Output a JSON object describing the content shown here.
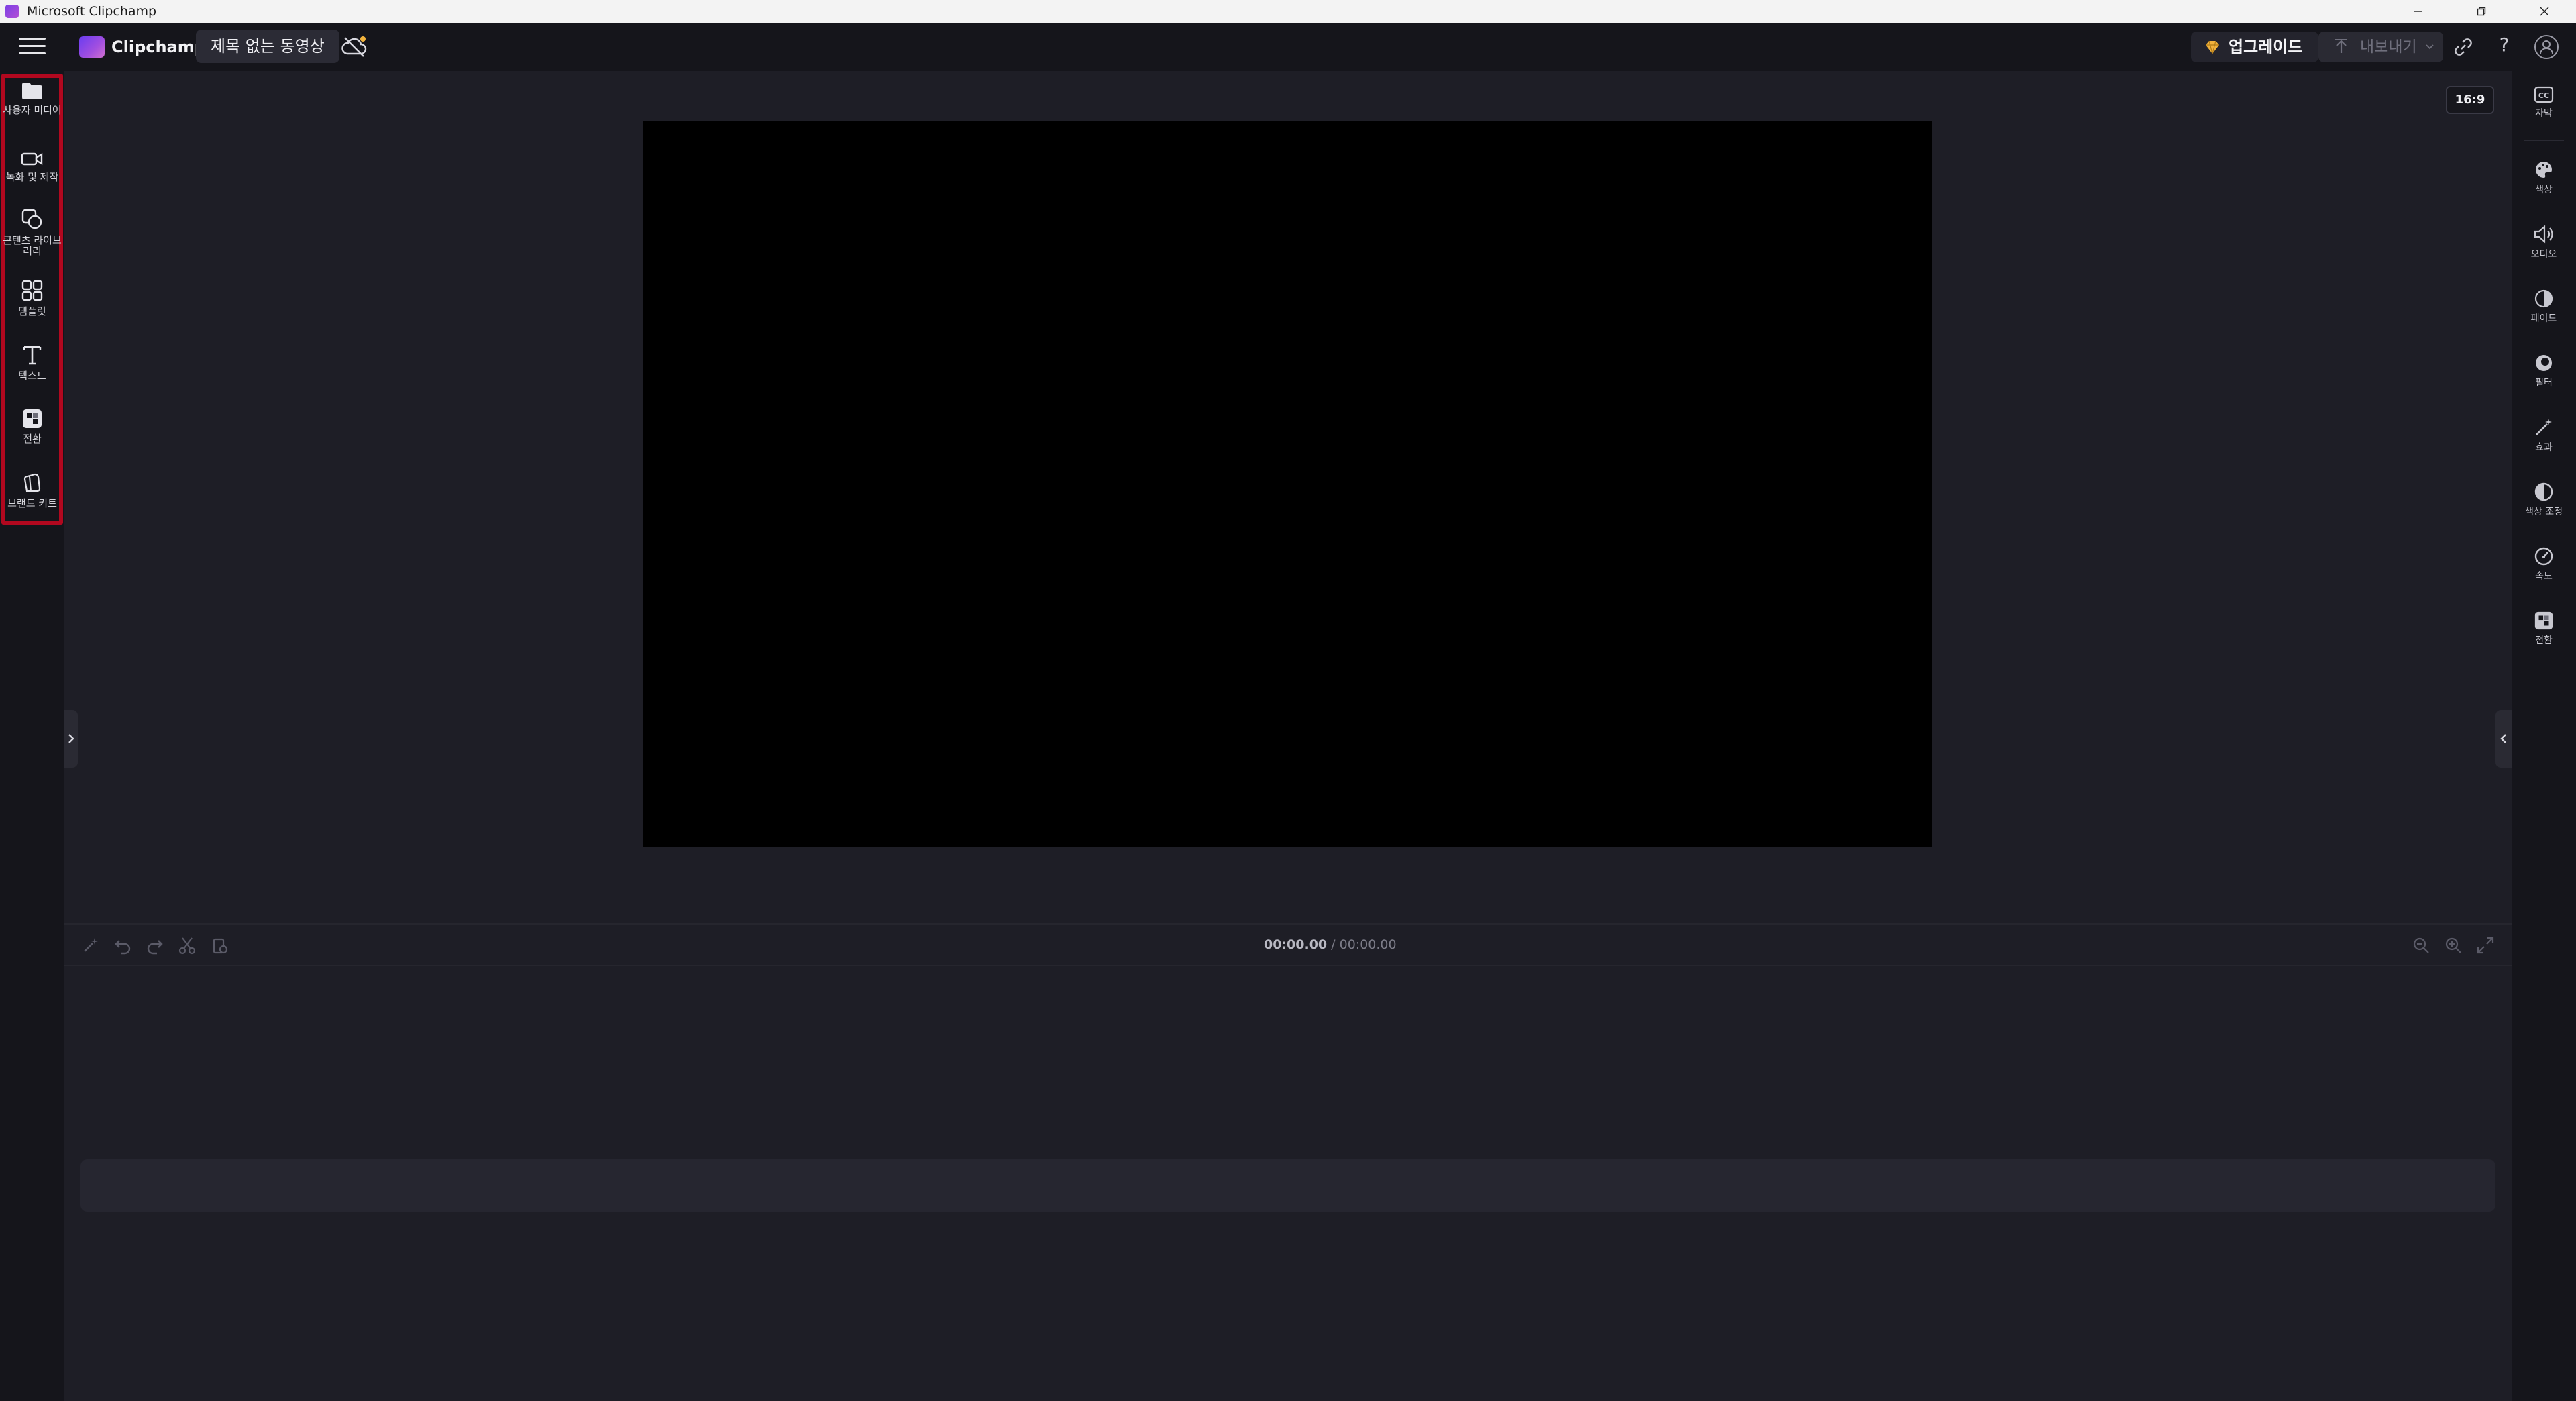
{
  "window": {
    "title": "Microsoft Clipchamp"
  },
  "topbar": {
    "brand": "Clipchamp",
    "project_title": "제목 없는 동영상",
    "upgrade_label": "업그레이드",
    "export_label": "내보내기",
    "help_label": "?"
  },
  "left_toolbar": {
    "highlight_color": "#b1081f",
    "items": [
      {
        "id": "media",
        "label": "사용자 미디어",
        "icon": "folder-icon"
      },
      {
        "id": "record",
        "label": "녹화 및 제작",
        "icon": "video-camera-icon"
      },
      {
        "id": "library",
        "label": "콘텐츠 라이브러리",
        "icon": "shapes-icon"
      },
      {
        "id": "templates",
        "label": "템플릿",
        "icon": "templates-grid-icon"
      },
      {
        "id": "text",
        "label": "텍스트",
        "icon": "text-t-icon"
      },
      {
        "id": "transitions",
        "label": "전환",
        "icon": "transition-icon"
      },
      {
        "id": "brandkit",
        "label": "브랜드 키트",
        "icon": "brand-kit-icon"
      }
    ]
  },
  "right_toolbar": {
    "items": [
      {
        "id": "captions",
        "label": "자막",
        "icon": "cc-icon"
      },
      {
        "id": "color",
        "label": "색상",
        "icon": "palette-icon"
      },
      {
        "id": "audio",
        "label": "오디오",
        "icon": "speaker-icon"
      },
      {
        "id": "fade",
        "label": "페이드",
        "icon": "fade-icon"
      },
      {
        "id": "filters",
        "label": "필터",
        "icon": "filter-icon"
      },
      {
        "id": "effects",
        "label": "효과",
        "icon": "magic-wand-icon"
      },
      {
        "id": "adjust",
        "label": "색상 조정",
        "icon": "contrast-icon"
      },
      {
        "id": "speed",
        "label": "속도",
        "icon": "speedometer-icon"
      },
      {
        "id": "transition",
        "label": "전환",
        "icon": "transition-icon"
      }
    ]
  },
  "preview": {
    "aspect_ratio": "16:9"
  },
  "timeline": {
    "current_time": "00:00.00",
    "separator": " / ",
    "total_time": "00:00.00"
  },
  "colors": {
    "app_bg": "#1e1e26",
    "panel_bg": "#15151b",
    "accent_purple": "#7b3fe4",
    "upgrade_gem": "#f2b33d"
  }
}
